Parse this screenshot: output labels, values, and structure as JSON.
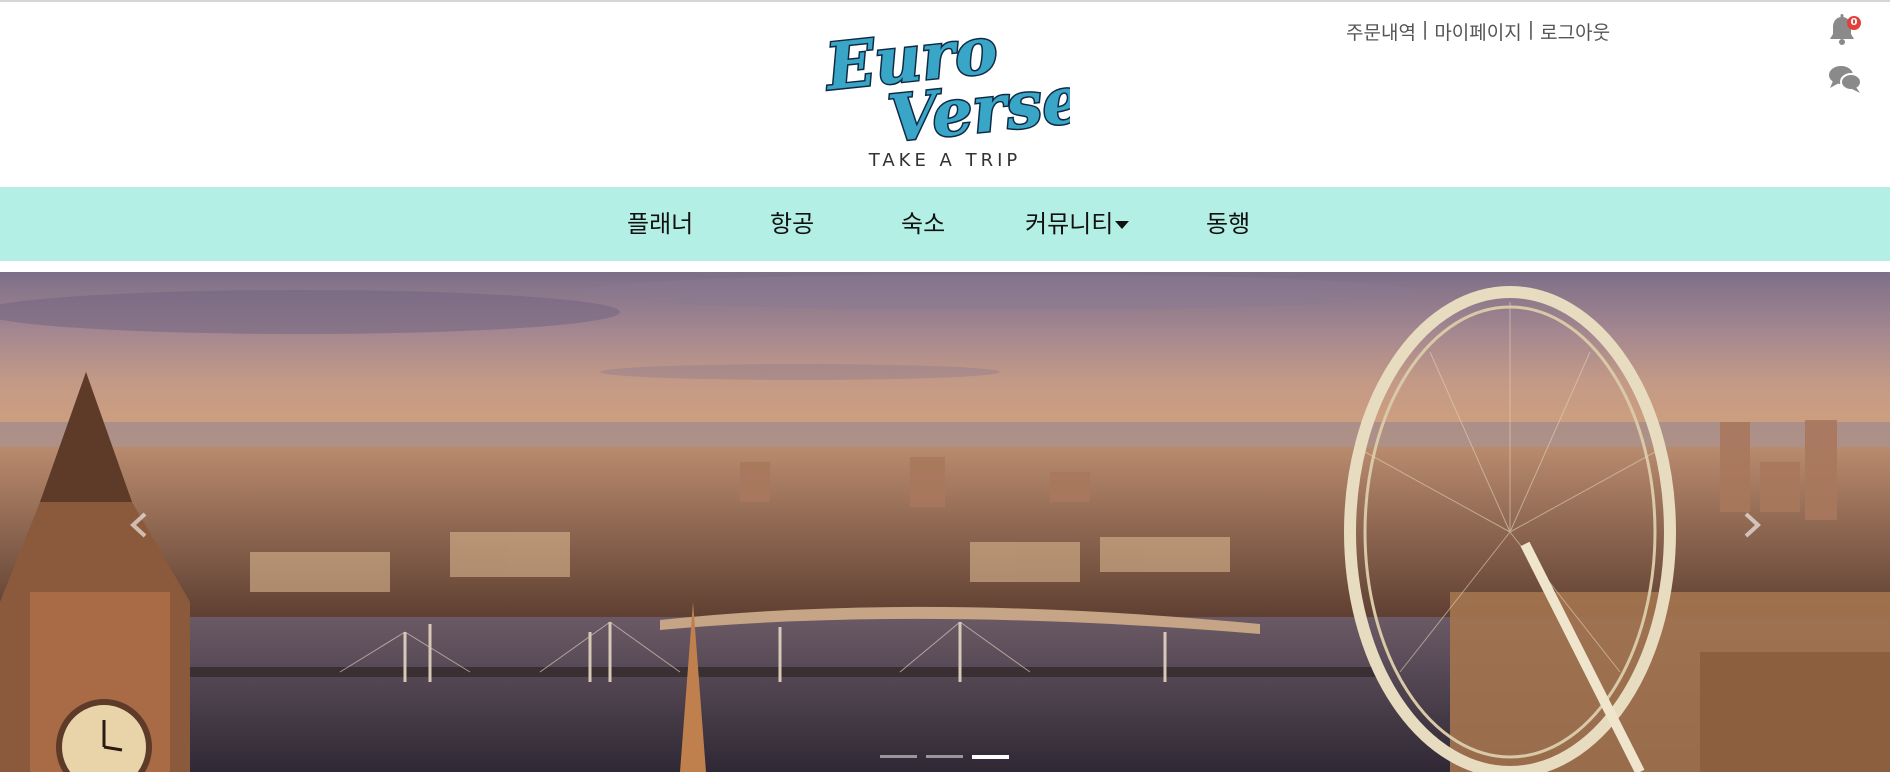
{
  "header": {
    "logo": {
      "line1": "Euro",
      "line2": "Verse",
      "tagline": "TAKE A TRIP",
      "colors": {
        "fill": "#3aa6c7",
        "outline": "#0f2a44"
      }
    },
    "top_links": [
      {
        "label": "주문내역"
      },
      {
        "label": "마이페이지"
      },
      {
        "label": "로그아웃"
      }
    ],
    "separator": "|",
    "notifications": {
      "icon": "bell-icon",
      "count": "0",
      "badge_color": "#e0413b"
    },
    "chat": {
      "icon": "chat-bubbles-icon"
    }
  },
  "nav": {
    "background": "#b4efe5",
    "items": [
      {
        "label": "플래너"
      },
      {
        "label": "항공"
      },
      {
        "label": "숙소"
      },
      {
        "label": "커뮤니티",
        "has_dropdown": true
      },
      {
        "label": "동행"
      }
    ]
  },
  "carousel": {
    "image_subject": "london-skyline-london-eye-big-ben",
    "prev_icon": "chevron-left-icon",
    "next_icon": "chevron-right-icon",
    "slide_count": 3,
    "active_index": 2
  }
}
